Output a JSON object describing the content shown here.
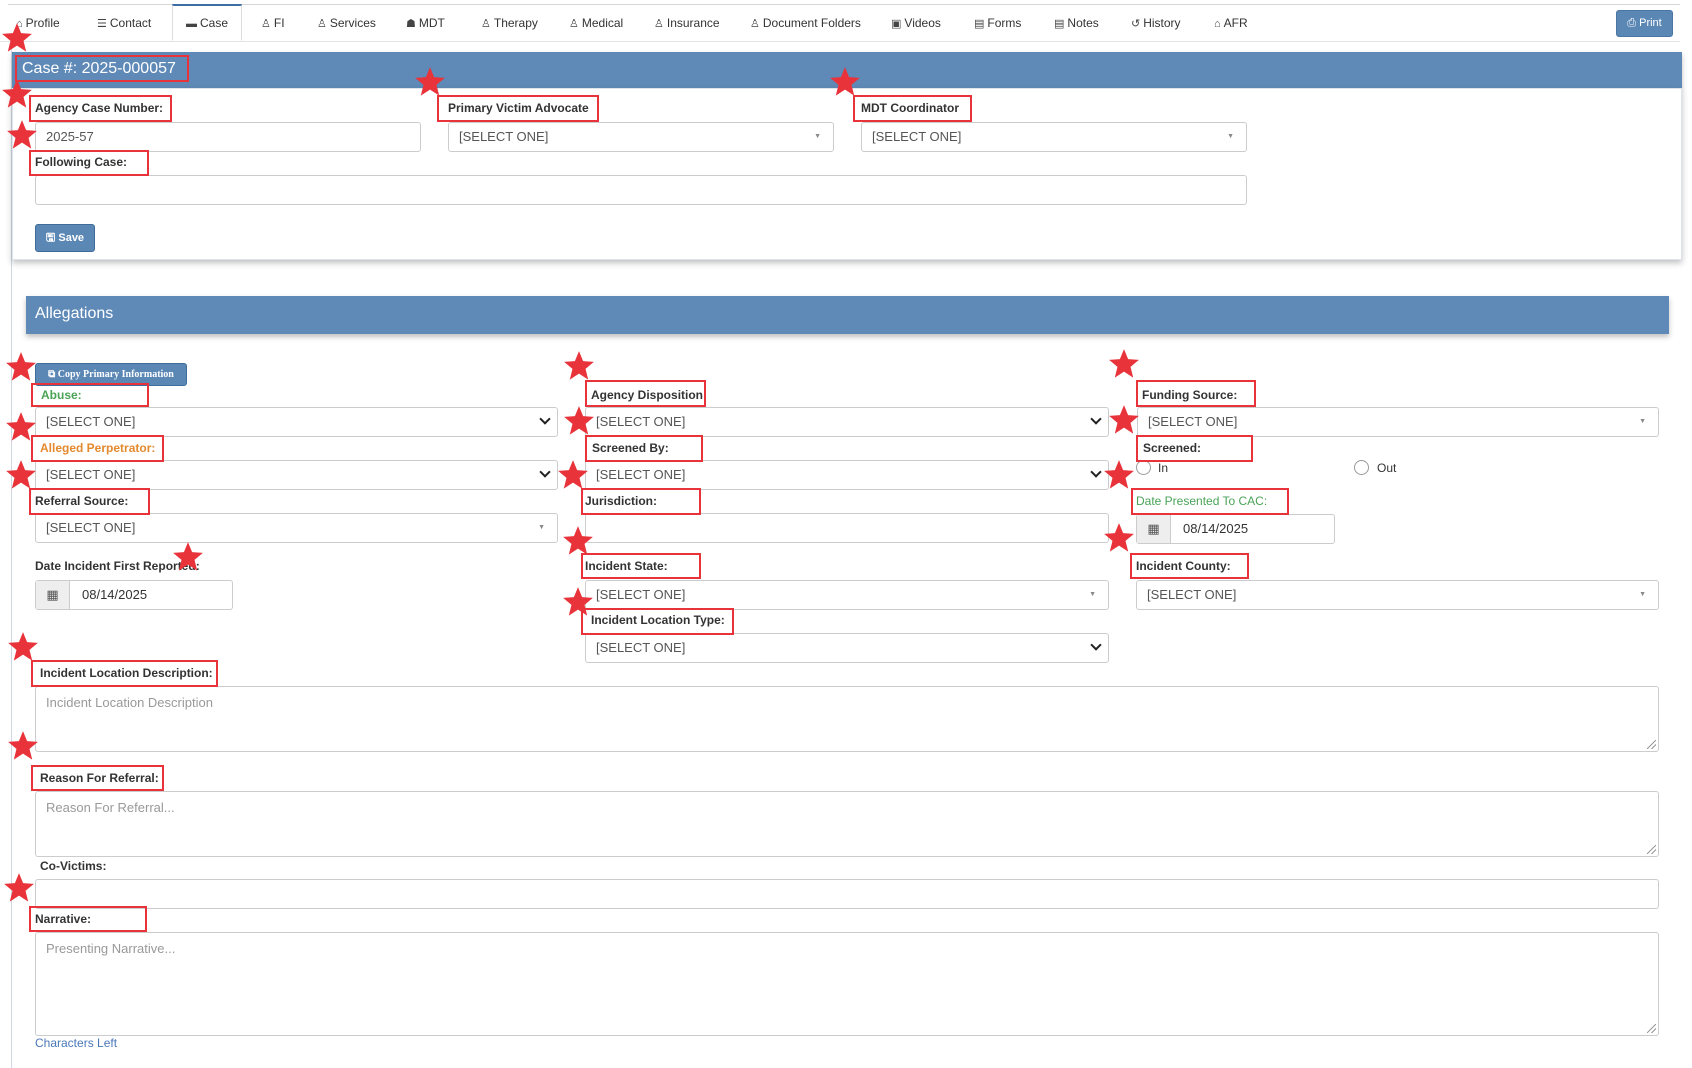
{
  "tabs": [
    {
      "label": "Profile",
      "icon": "home-icon"
    },
    {
      "label": "Contact",
      "icon": "list-icon"
    },
    {
      "label": "Case",
      "icon": "briefcase-icon"
    },
    {
      "label": "FI",
      "icon": "person-icon"
    },
    {
      "label": "Services",
      "icon": "person-icon"
    },
    {
      "label": "MDT",
      "icon": "group-icon"
    },
    {
      "label": "Therapy",
      "icon": "person-icon"
    },
    {
      "label": "Medical",
      "icon": "person-icon"
    },
    {
      "label": "Insurance",
      "icon": "person-icon"
    },
    {
      "label": "Document Folders",
      "icon": "person-icon"
    },
    {
      "label": "Videos",
      "icon": "video-icon"
    },
    {
      "label": "Forms",
      "icon": "file-icon"
    },
    {
      "label": "Notes",
      "icon": "file-icon"
    },
    {
      "label": "History",
      "icon": "history-icon"
    },
    {
      "label": "AFR",
      "icon": "home-icon"
    }
  ],
  "active_tab": "Case",
  "print_label": "Print",
  "case_panel": {
    "title": "Case #: 2025-000057",
    "agency_case_number": {
      "label": "Agency Case Number:",
      "value": "2025-57"
    },
    "primary_victim_advocate": {
      "label": "Primary Victim Advocate",
      "value": "[SELECT ONE]"
    },
    "mdt_coordinator": {
      "label": "MDT Coordinator",
      "value": "[SELECT ONE]"
    },
    "following_case": {
      "label": "Following Case:",
      "value": ""
    },
    "save_label": "Save"
  },
  "allegations_panel": {
    "title": "Allegations",
    "copy_button_label": "Copy Primary Information",
    "abuse": {
      "label": "Abuse:",
      "value": "[SELECT ONE]"
    },
    "agency_disposition": {
      "label": "Agency Disposition:",
      "value": "[SELECT ONE]"
    },
    "funding_source": {
      "label": "Funding Source:",
      "value": "[SELECT ONE]"
    },
    "alleged_perpetrator": {
      "label": "Alleged Perpetrator:",
      "value": "[SELECT ONE]"
    },
    "screened_by": {
      "label": "Screened By:",
      "value": "[SELECT ONE]"
    },
    "screened": {
      "label": "Screened:",
      "options": [
        "In",
        "Out"
      ]
    },
    "referral_source": {
      "label": "Referral Source:",
      "value": "[SELECT ONE]"
    },
    "jurisdiction": {
      "label": "Jurisdiction:",
      "value": ""
    },
    "date_presented": {
      "label": "Date Presented To CAC:",
      "value": "08/14/2025"
    },
    "date_incident_first_reported": {
      "label": "Date Incident First Reported:",
      "value": "08/14/2025"
    },
    "incident_state": {
      "label": "Incident State:",
      "value": "[SELECT ONE]"
    },
    "incident_county": {
      "label": "Incident County:",
      "value": "[SELECT ONE]"
    },
    "incident_location_type": {
      "label": "Incident Location Type:",
      "value": "[SELECT ONE]"
    },
    "incident_location_description": {
      "label": "Incident Location Description:",
      "placeholder": "Incident Location Description"
    },
    "reason_for_referral": {
      "label": "Reason For Referral:",
      "placeholder": "Reason For Referral..."
    },
    "co_victims": {
      "label": "Co-Victims:",
      "value": ""
    },
    "narrative": {
      "label": "Narrative:",
      "placeholder": "Presenting Narrative..."
    },
    "characters_left": "Characters Left"
  },
  "colors": {
    "panel_header": "#5f8ab7",
    "annotation": "#e8333a",
    "required_green": "#4aa357",
    "required_orange": "#e38a2e"
  }
}
